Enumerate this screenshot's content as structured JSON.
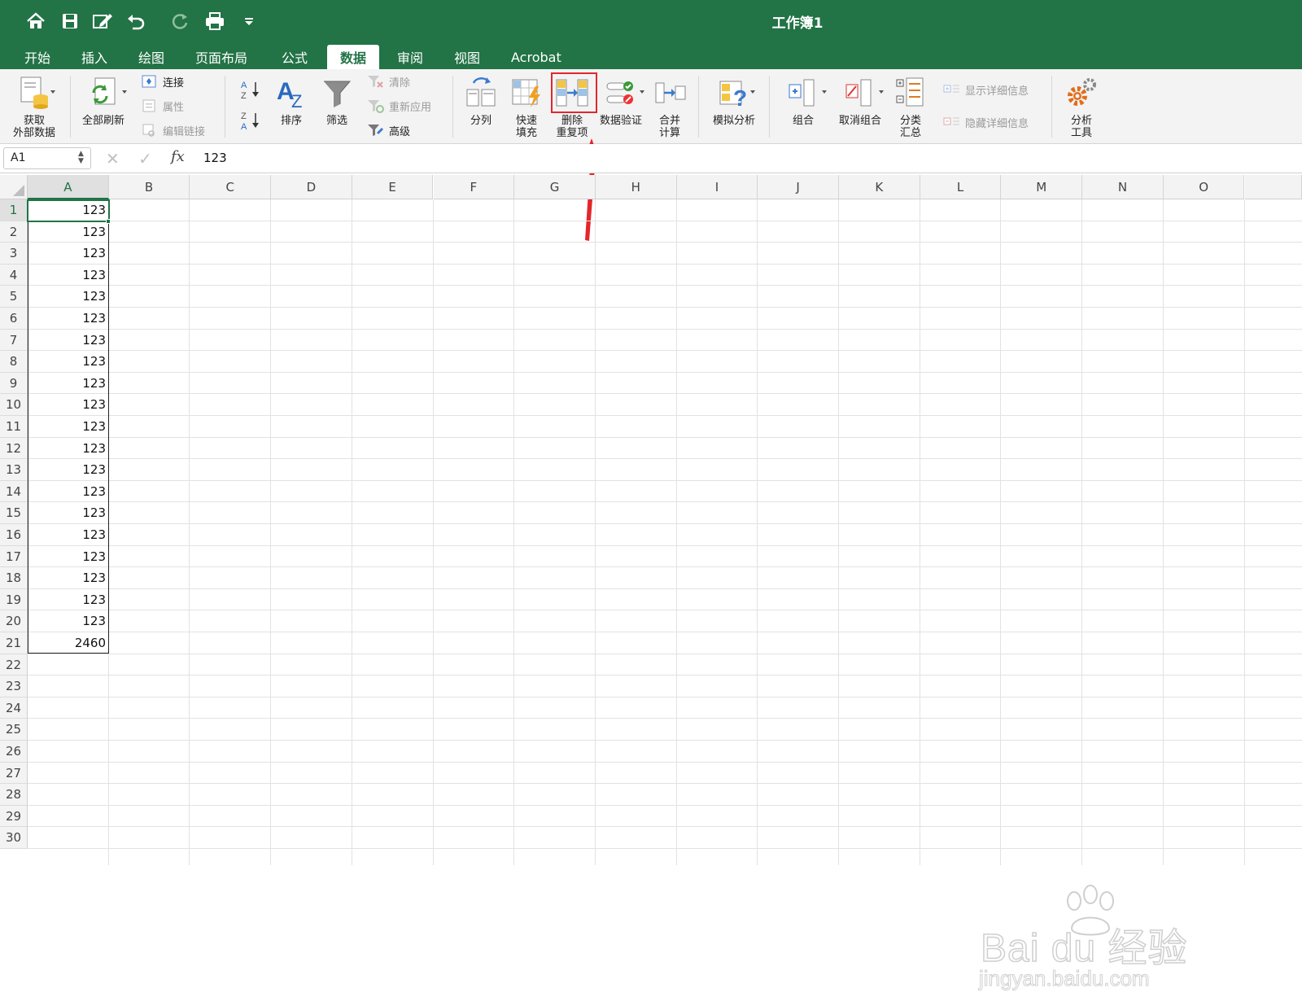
{
  "app": {
    "workbook_title": "工作簿1",
    "accent": "#227346"
  },
  "quick_access": [
    "home-icon",
    "save-icon",
    "edit-icon",
    "undo-icon",
    "redo-icon",
    "print-icon",
    "customize-icon"
  ],
  "tabs": [
    {
      "label": "开始"
    },
    {
      "label": "插入"
    },
    {
      "label": "绘图"
    },
    {
      "label": "页面布局"
    },
    {
      "label": "公式"
    },
    {
      "label": "数据",
      "active": true
    },
    {
      "label": "审阅"
    },
    {
      "label": "视图"
    },
    {
      "label": "Acrobat"
    }
  ],
  "ribbon": {
    "get_data": {
      "line1": "获取",
      "line2": "外部数据"
    },
    "refresh_all": "全部刷新",
    "connections": "连接",
    "properties": "属性",
    "edit_links": "编辑链接",
    "sort": "排序",
    "filter": "筛选",
    "clear": "清除",
    "reapply": "重新应用",
    "advanced": "高级",
    "text_to_columns": "分列",
    "flash_fill": {
      "line1": "快速",
      "line2": "填充"
    },
    "remove_duplicates": {
      "line1": "删除",
      "line2": "重复项"
    },
    "data_validation": "数据验证",
    "consolidate": {
      "line1": "合并",
      "line2": "计算"
    },
    "what_if": "模拟分析",
    "group": "组合",
    "ungroup": "取消组合",
    "subtotal": {
      "line1": "分类",
      "line2": "汇总"
    },
    "show_detail": "显示详细信息",
    "hide_detail": "隐藏详细信息",
    "analysis_tools": {
      "line1": "分析",
      "line2": "工具"
    }
  },
  "formula_bar": {
    "name_box": "A1",
    "cancel": "✕",
    "enter": "✓",
    "fx": "fx",
    "value": "123"
  },
  "columns": [
    "A",
    "B",
    "C",
    "D",
    "E",
    "F",
    "G",
    "H",
    "I",
    "J",
    "K",
    "L",
    "M",
    "N",
    "O"
  ],
  "rows": [
    "1",
    "2",
    "3",
    "4",
    "5",
    "6",
    "7",
    "8",
    "9",
    "10",
    "11",
    "12",
    "13",
    "14",
    "15",
    "16",
    "17",
    "18",
    "19",
    "20",
    "21",
    "22",
    "23",
    "24",
    "25",
    "26",
    "27",
    "28",
    "29",
    "30"
  ],
  "cells_A": [
    "123",
    "123",
    "123",
    "123",
    "123",
    "123",
    "123",
    "123",
    "123",
    "123",
    "123",
    "123",
    "123",
    "123",
    "123",
    "123",
    "123",
    "123",
    "123",
    "123",
    "2460"
  ],
  "selected_cell": "A1",
  "watermark": {
    "brand": "Bai du 经验",
    "url": "jingyan.baidu.com"
  }
}
